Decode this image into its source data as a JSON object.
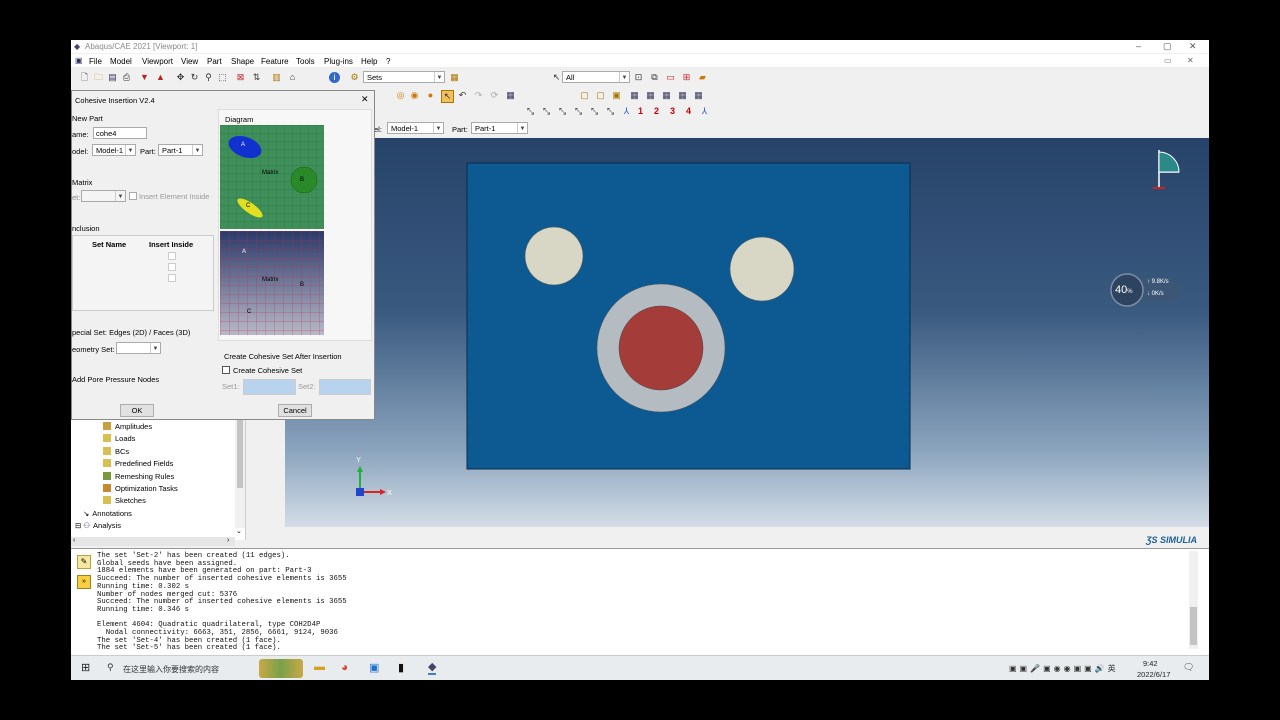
{
  "window": {
    "title": "Abaqus/CAE 2021 [Viewport: 1]",
    "min": "–",
    "max": "▢",
    "close": "✕"
  },
  "menu": [
    "File",
    "Model",
    "Viewport",
    "View",
    "Part",
    "Shape",
    "Feature",
    "Tools",
    "Plug-ins",
    "Help",
    "?"
  ],
  "toolbar": {
    "sets_combo": "Sets",
    "select_combo": "All",
    "model_label": "el:",
    "model_value": "Model-1",
    "part_label": "Part:",
    "part_value": "Part-1",
    "view_numbers": [
      "1",
      "2",
      "3",
      "4"
    ]
  },
  "dialog": {
    "title": "Cohesive Insertion V2.4",
    "close": "✕",
    "new_part_heading": "New Part",
    "name_label": "ame:",
    "name_value": "cohe4",
    "model_label": "odel:",
    "model_value": "Model-1",
    "part_label": "Part:",
    "part_value": "Part-1",
    "matrix_heading": "Matrix",
    "set_label": "et:",
    "insert_element_inside": "Insert Element Inside",
    "inclusion_heading": "nclusion",
    "col_set_name": "Set Name",
    "col_insert_inside": "Insert Inside",
    "special_set_heading": "pecial Set: Edges (2D) / Faces (3D)",
    "geometry_set_label": "eometry Set:",
    "pore_pressure": "Add Pore Pressure Nodes",
    "diagram_heading": "Diagram",
    "diagram_labels": {
      "a": "A",
      "b": "B",
      "c": "C",
      "matrix": "Matrix"
    },
    "create_set_heading": "Create Cohesive Set After Insertion",
    "create_set_checkbox": "Create Cohesive Set",
    "set1_label": "Set1:",
    "set2_label": "Set2:",
    "ok": "OK",
    "cancel": "Cancel"
  },
  "tree": [
    "Amplitudes",
    "Loads",
    "BCs",
    "Predefined Fields",
    "Remeshing Rules",
    "Optimization Tasks",
    "Sketches",
    "Annotations",
    "Analysis"
  ],
  "viewport": {
    "plate_color": "#0d5a93",
    "inclusion_color": "#d8d6c4",
    "ring_color": "#b4bcc2",
    "core_color": "#a43c3a",
    "triad": {
      "y": "Y",
      "x": "X"
    },
    "gauge": {
      "percent": "40",
      "unit": "%",
      "up": "9.8",
      "up_unit": "K/s",
      "down": "0",
      "down_unit": "K/s"
    },
    "brand": "SIMULIA"
  },
  "messages": [
    "The set 'Set-2' has been created (11 edges).",
    "Global seeds have been assigned.",
    "1884 elements have been generated on part: Part-3",
    "Succeed: The number of inserted cohesive elements is 3655",
    "Running time: 0.302 s",
    "Number of nodes merged cut: 5376",
    "Succeed: The number of inserted cohesive elements is 3655",
    "Running time: 0.346 s",
    "",
    "Element 4604: Quadratic quadrilateral, type COH2D4P",
    "  Nodal connectivity: 6663, 351, 2856, 6661, 9124, 9036",
    "The set 'Set-4' has been created (1 face).",
    "The set 'Set-5' has been created (1 face)."
  ],
  "taskbar": {
    "search_placeholder": "在这里输入你要搜索的内容",
    "time": "9:42",
    "date": "2022/6/17"
  }
}
